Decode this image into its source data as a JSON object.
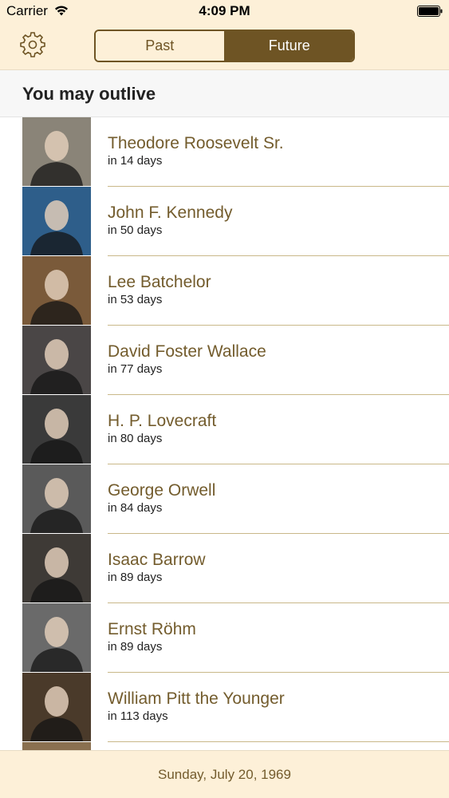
{
  "status_bar": {
    "carrier": "Carrier",
    "time": "4:09 PM",
    "wifi_icon": "wifi-icon",
    "battery_icon": "battery-icon"
  },
  "nav": {
    "settings_icon": "gear-icon",
    "segments": [
      {
        "label": "Past",
        "selected": false
      },
      {
        "label": "Future",
        "selected": true
      }
    ]
  },
  "section": {
    "title": "You may outlive"
  },
  "people": [
    {
      "name": "Theodore Roosevelt Sr.",
      "when": "in 14 days",
      "photo_tone": "#8a8478"
    },
    {
      "name": "John F. Kennedy",
      "when": "in 50 days",
      "photo_tone": "#2e5e8a"
    },
    {
      "name": "Lee Batchelor",
      "when": "in 53 days",
      "photo_tone": "#7a5a3a"
    },
    {
      "name": "David Foster Wallace",
      "when": "in 77 days",
      "photo_tone": "#4a4646"
    },
    {
      "name": "H. P. Lovecraft",
      "when": "in 80 days",
      "photo_tone": "#3a3a3a"
    },
    {
      "name": "George Orwell",
      "when": "in 84 days",
      "photo_tone": "#5a5a5a"
    },
    {
      "name": "Isaac Barrow",
      "when": "in 89 days",
      "photo_tone": "#3e3a36"
    },
    {
      "name": "Ernst Röhm",
      "when": "in 89 days",
      "photo_tone": "#6a6a6a"
    },
    {
      "name": "William Pitt the Younger",
      "when": "in 113 days",
      "photo_tone": "#4a3a2a"
    },
    {
      "name": "",
      "when": "",
      "photo_tone": "#8a7050"
    }
  ],
  "footer": {
    "date": "Sunday, July 20, 1969"
  },
  "colors": {
    "accent": "#6e5424",
    "bar_background": "#fdf0d8",
    "name_text": "#735c2d",
    "separator": "#c9b889"
  }
}
